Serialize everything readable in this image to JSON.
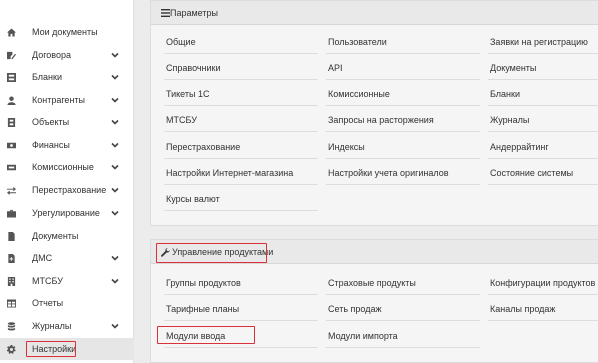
{
  "sidebar": {
    "items": [
      {
        "label": "Мои документы",
        "icon": "home-icon",
        "expandable": false
      },
      {
        "label": "Договора",
        "icon": "contract-icon",
        "expandable": true
      },
      {
        "label": "Бланки",
        "icon": "forms-icon",
        "expandable": true
      },
      {
        "label": "Контрагенты",
        "icon": "user-icon",
        "expandable": true
      },
      {
        "label": "Объекты",
        "icon": "object-icon",
        "expandable": true
      },
      {
        "label": "Финансы",
        "icon": "money-icon",
        "expandable": true
      },
      {
        "label": "Комиссионные",
        "icon": "commission-icon",
        "expandable": true
      },
      {
        "label": "Перестрахование",
        "icon": "exchange-icon",
        "expandable": true
      },
      {
        "label": "Урегулирование",
        "icon": "briefcase-icon",
        "expandable": true
      },
      {
        "label": "Документы",
        "icon": "document-icon",
        "expandable": false
      },
      {
        "label": "ДМС",
        "icon": "medical-document-icon",
        "expandable": true
      },
      {
        "label": "МТСБУ",
        "icon": "building-icon",
        "expandable": true
      },
      {
        "label": "Отчеты",
        "icon": "table-icon",
        "expandable": false
      },
      {
        "label": "Журналы",
        "icon": "database-icon",
        "expandable": true
      },
      {
        "label": "Настройки",
        "icon": "gear-icon",
        "expandable": false,
        "active": true
      }
    ]
  },
  "params_panel": {
    "title": "Параметры",
    "icon": "bars-icon",
    "col1": [
      "Общие",
      "Справочники",
      "Тикеты 1С",
      "МТСБУ",
      "Перестрахование",
      "Настройки Интернет-магазина",
      "Курсы валют"
    ],
    "col2": [
      "Пользователи",
      "API",
      "Комиссионные",
      "Запросы на расторжения",
      "Индексы",
      "Настройки учета оригиналов"
    ],
    "col3": [
      "Заявки на регистрацию",
      "Документы",
      "Бланки",
      "Журналы",
      "Андеррайтинг",
      "Состояние системы"
    ]
  },
  "products_panel": {
    "title": "Управление продуктами",
    "icon": "wrench-icon",
    "col1": [
      "Группы продуктов",
      "Тарифные планы",
      "Модули ввода"
    ],
    "col2": [
      "Страховые продукты",
      "Сеть продаж",
      "Модули импорта"
    ],
    "col3": [
      "Конфигурации продуктов",
      "Каналы продаж"
    ]
  },
  "colors": {
    "highlight": "#d9303a",
    "panel_bg": "#f5f5f5",
    "header_bg": "#e9e9e9"
  }
}
